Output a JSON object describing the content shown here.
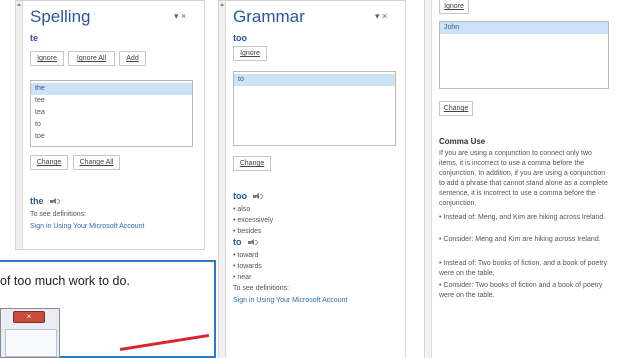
{
  "spelling": {
    "title": "Spelling",
    "controls": "▾ ×",
    "word": "te",
    "buttons": {
      "ignore": "Ignore",
      "ignore_all": "Ignore All",
      "add": "Add",
      "change": "Change",
      "change_all": "Change All"
    },
    "suggestions": [
      "the",
      "tee",
      "tea",
      "to",
      "toe"
    ],
    "def_word": "the",
    "see_definitions": "To see definitions:",
    "sign_in": "Sign in Using Your Microsoft Account"
  },
  "grammar": {
    "title": "Grammar",
    "controls": "▾ ×",
    "word": "too",
    "buttons": {
      "ignore": "Ignore",
      "change": "Change"
    },
    "suggestions": [
      "to"
    ],
    "def_too": "too",
    "too_bullets": [
      "• also",
      "• excessively",
      "• besides"
    ],
    "def_to": "to",
    "to_bullets": [
      "• toward",
      "• towards",
      "• near"
    ],
    "see_definitions": "To see definitions:",
    "sign_in": "Sign in Using Your Microsoft Account"
  },
  "third": {
    "buttons": {
      "ignore": "Ignore",
      "change": "Change"
    },
    "suggestions": [
      "John"
    ],
    "rule_title": "Comma Use",
    "rule_text": "If you are using a conjunction to connect only two items, it is incorrect to use a comma before the conjunction. In addition, if you are using a conjunction to add a phrase that cannot stand alone as a complete sentence, it is incorrect to use a comma before the conjunction.",
    "examples": [
      "• Instead of: Meng, and Kim are hiking across Ireland.",
      "• Consider: Meng and Kim are hiking across Ireland.",
      "• Instead of: Two books of fiction, and a book of poetry were on the table.",
      "• Consider: Two books of fiction and a book of poetry were on the table."
    ]
  },
  "document": {
    "text": "of too much work to do.",
    "dialog_close": "×"
  }
}
